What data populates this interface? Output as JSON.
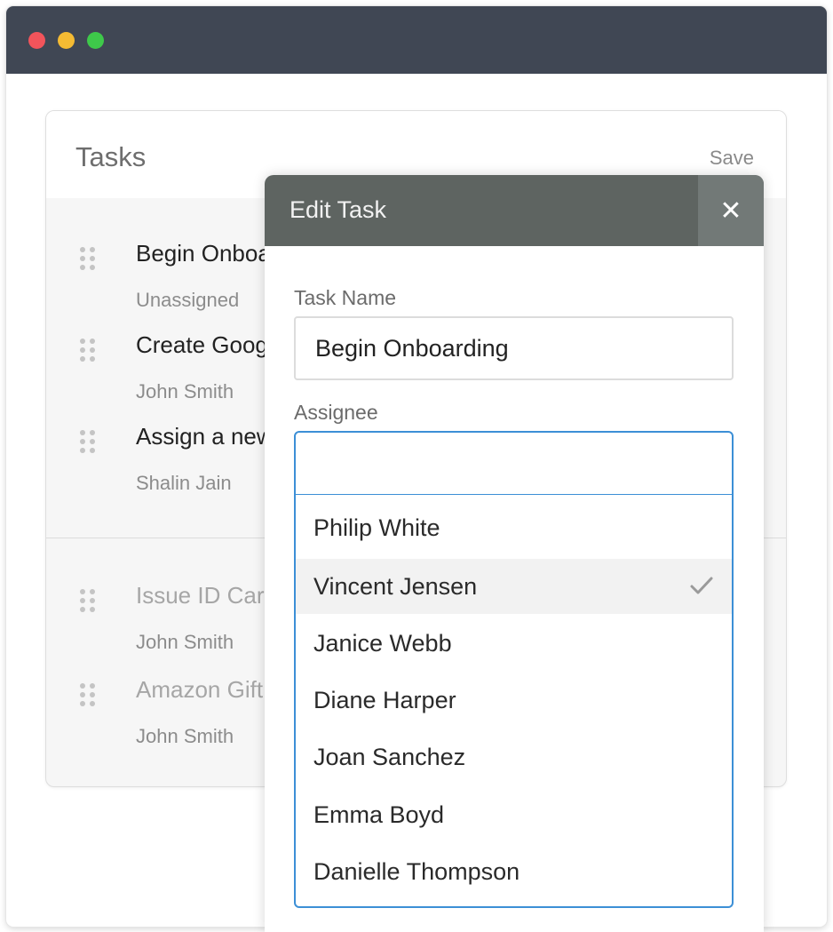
{
  "window": {
    "controls": [
      "close",
      "minimize",
      "maximize"
    ]
  },
  "tasks": {
    "title": "Tasks",
    "save_label": "Save",
    "active": [
      {
        "name": "Begin Onboarding",
        "assignee": "Unassigned"
      },
      {
        "name": "Create Google Account",
        "assignee": "John Smith"
      },
      {
        "name": "Assign a new laptop",
        "assignee": "Shalin Jain"
      }
    ],
    "completed": [
      {
        "name": "Issue ID Card",
        "assignee": "John Smith"
      },
      {
        "name": "Amazon Gift Card",
        "assignee": "John Smith"
      }
    ]
  },
  "modal": {
    "title": "Edit Task",
    "close_icon": "close-icon",
    "task_name_label": "Task Name",
    "task_name_value": "Begin Onboarding",
    "assignee_label": "Assignee",
    "assignee_value": "",
    "options": [
      {
        "label": "Philip White",
        "selected": false
      },
      {
        "label": "Vincent Jensen",
        "selected": true
      },
      {
        "label": "Janice Webb",
        "selected": false
      },
      {
        "label": "Diane Harper",
        "selected": false
      },
      {
        "label": "Joan Sanchez",
        "selected": false
      },
      {
        "label": "Emma Boyd",
        "selected": false
      },
      {
        "label": "Danielle Thompson",
        "selected": false
      }
    ]
  },
  "colors": {
    "titlebar": "#404754",
    "modal_header": "#5e6461",
    "accent": "#3c8fd6",
    "close_red": "#f2545b",
    "minimize_yellow": "#f5bb33",
    "maximize_green": "#3ec94a"
  }
}
